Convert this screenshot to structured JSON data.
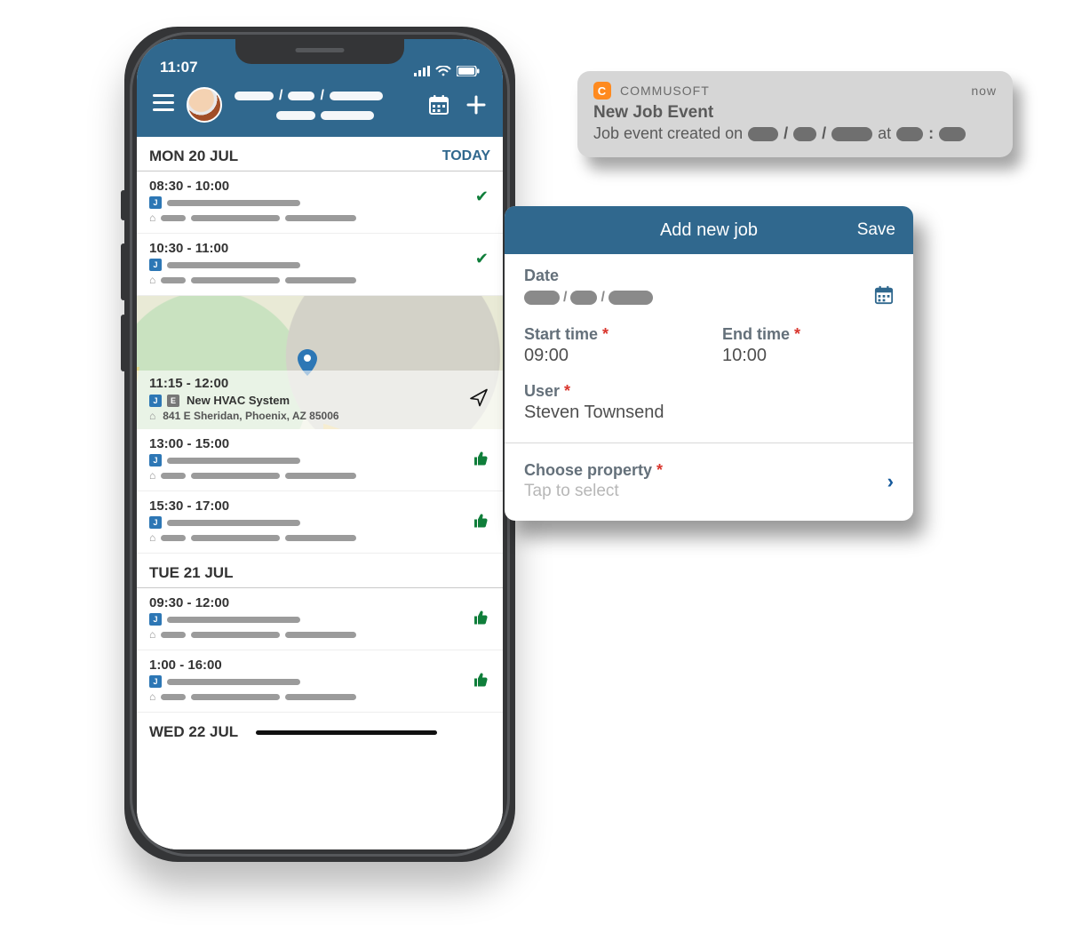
{
  "phone": {
    "statusbar": {
      "time": "11:07"
    },
    "days": [
      {
        "label": "MON 20 JUL",
        "today": "TODAY",
        "jobs": [
          {
            "time": "08:30 - 10:00",
            "status": "check"
          },
          {
            "time": "10:30 - 11:00",
            "status": "check"
          },
          {
            "time": "11:15 - 12:00",
            "status": "nav",
            "badge": "E",
            "title": "New HVAC System",
            "address": "841 E Sheridan, Phoenix, AZ 85006",
            "map": true
          },
          {
            "time": "13:00 - 15:00",
            "status": "thumb"
          },
          {
            "time": "15:30 - 17:00",
            "status": "thumb"
          }
        ]
      },
      {
        "label": "TUE 21 JUL",
        "jobs": [
          {
            "time": "09:30 - 12:00",
            "status": "thumb"
          },
          {
            "time": "1:00 - 16:00",
            "status": "thumb"
          }
        ]
      },
      {
        "label": "WED 22 JUL",
        "jobs": []
      }
    ]
  },
  "push": {
    "app": "COMMUSOFT",
    "when": "now",
    "title": "New Job Event",
    "body_prefix": "Job event created on",
    "body_mid": "at"
  },
  "sheet": {
    "title": "Add new job",
    "save": "Save",
    "date_label": "Date",
    "start_label": "Start time",
    "end_label": "End time",
    "start_value": "09:00",
    "end_value": "10:00",
    "user_label": "User",
    "user_value": "Steven Townsend",
    "prop_label": "Choose property",
    "prop_placeholder": "Tap to select"
  }
}
